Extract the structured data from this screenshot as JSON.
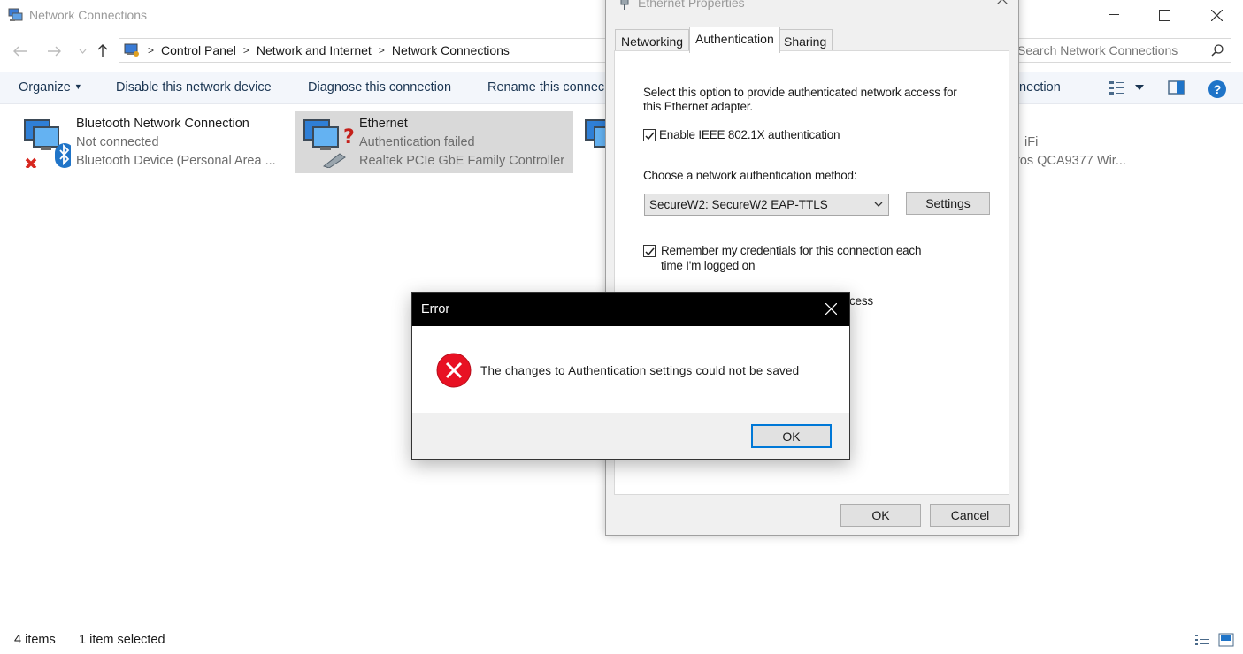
{
  "explorer": {
    "window_title": "Network Connections",
    "breadcrumb": [
      "Control Panel",
      "Network and Internet",
      "Network Connections"
    ],
    "search_placeholder": "Search Network Connections",
    "commands": {
      "organize": "Organize",
      "disable": "Disable this network device",
      "diagnose": "Diagnose this connection",
      "rename": "Rename this connec",
      "change_settings_partial": "nection"
    },
    "items": [
      {
        "name": "Bluetooth Network Connection",
        "status": "Not connected",
        "device": "Bluetooth Device (Personal Area ..."
      },
      {
        "name": "Ethernet",
        "status": "Authentication failed",
        "device": "Realtek PCIe GbE Family Controller"
      },
      {
        "name": "",
        "status": "iFi",
        "device": "ros QCA9377 Wir..."
      }
    ],
    "status": {
      "count": "4 items",
      "selected": "1 item selected"
    }
  },
  "properties": {
    "title": "Ethernet Properties",
    "tabs": [
      "Networking",
      "Authentication",
      "Sharing"
    ],
    "active_tab": "Authentication",
    "intro_line1": "Select this option to provide authenticated network access for",
    "intro_line2": "this Ethernet adapter.",
    "enable_8021x": "Enable IEEE 802.1X authentication",
    "enable_8021x_checked": true,
    "method_label": "Choose a network authentication method:",
    "method_value": "SecureW2: SecureW2 EAP-TTLS",
    "settings_button": "Settings",
    "remember_line1": "Remember my credentials for this connection each",
    "remember_line2": "time I'm logged on",
    "remember_checked": true,
    "fallback_partial": "cess",
    "ok": "OK",
    "cancel": "Cancel"
  },
  "error": {
    "title": "Error",
    "message": "The changes to Authentication settings could not be saved",
    "ok": "OK"
  },
  "colors": {
    "error_red": "#e81123",
    "accent_blue": "#0078d7",
    "selection_gray": "#d9d9d9"
  }
}
